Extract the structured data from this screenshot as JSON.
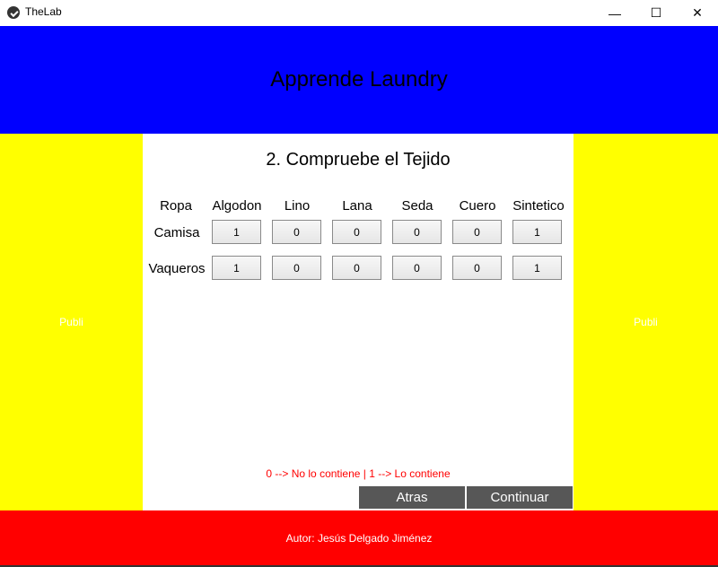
{
  "window": {
    "title": "TheLab",
    "minimize_glyph": "—",
    "maximize_glyph": "☐",
    "close_glyph": "✕",
    "icon": "kivy-logo-icon"
  },
  "header": {
    "title": "Apprende Laundry"
  },
  "sidebars": {
    "left_text": "Publi",
    "right_text": "Publi"
  },
  "main": {
    "section_title": "2. Compruebe el Tejido",
    "columns": [
      "Ropa",
      "Algodon",
      "Lino",
      "Lana",
      "Seda",
      "Cuero",
      "Sintetico"
    ],
    "rows": [
      {
        "label": "Camisa",
        "values": [
          "1",
          "0",
          "0",
          "0",
          "0",
          "1"
        ]
      },
      {
        "label": "Vaqueros",
        "values": [
          "1",
          "0",
          "0",
          "0",
          "0",
          "1"
        ]
      }
    ],
    "legend": "0 --> No lo contiene | 1 --> Lo contiene",
    "back_label": "Atras",
    "continue_label": "Continuar"
  },
  "footer": {
    "author": "Autor: Jesús Delgado Jiménez"
  },
  "colors": {
    "header": "#0000ff",
    "sidebar": "#ffff00",
    "footer": "#ff0000",
    "legend": "#ff0000",
    "button": "#575757"
  }
}
